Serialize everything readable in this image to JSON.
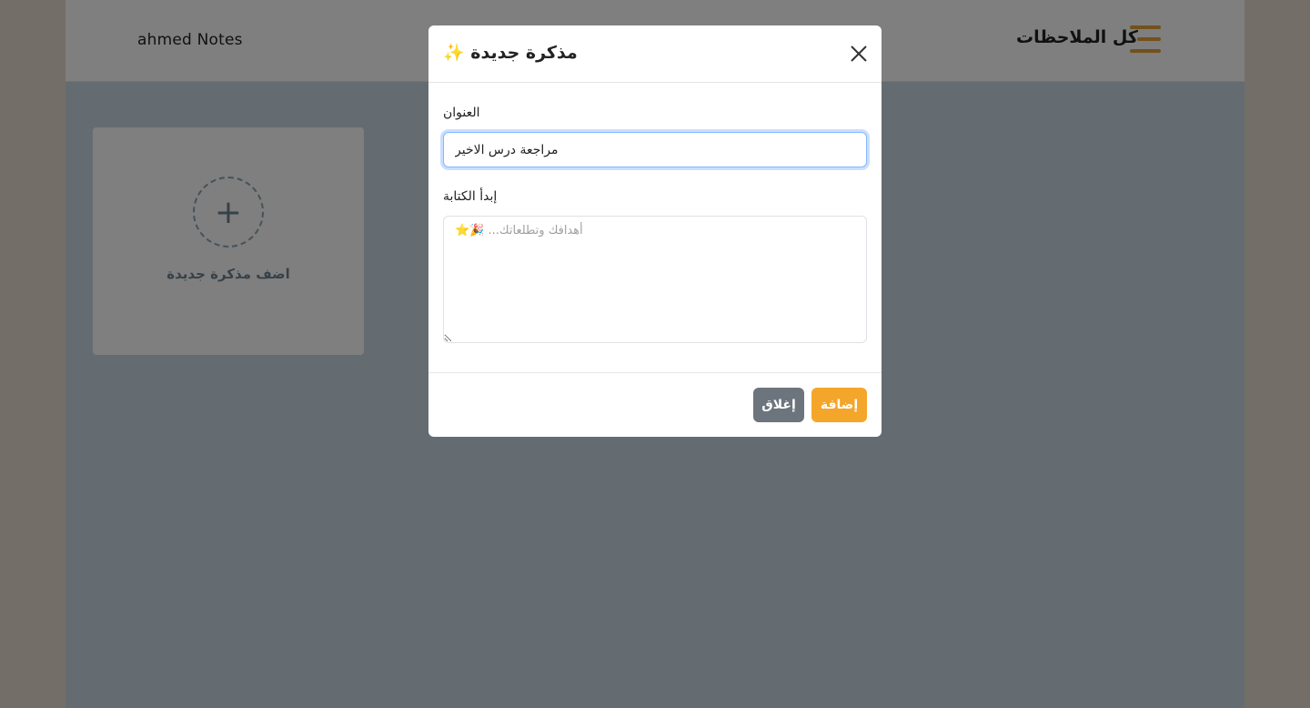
{
  "header": {
    "brand": "ahmed Notes",
    "nav_title": "كل الملاحظات",
    "menu_icon": "hamburger-icon",
    "accent_color": "#e4a23a"
  },
  "add_card": {
    "icon": "plus-icon",
    "icon_glyph": "+",
    "label": "اضف مذكرة جديدة"
  },
  "modal": {
    "title": "مذكرة جديدة ✨",
    "close_icon": "close-icon",
    "title_label": "العنوان",
    "title_value": "مراجعة درس الاخير",
    "body_label": "إبدأ الكتابة",
    "body_placeholder": "أهدافك وتطلعاتك... 🎉⭐",
    "close_button": "إغلاق",
    "add_button": "إضافة",
    "add_color": "#f4a62a",
    "close_color": "#6c757d"
  }
}
